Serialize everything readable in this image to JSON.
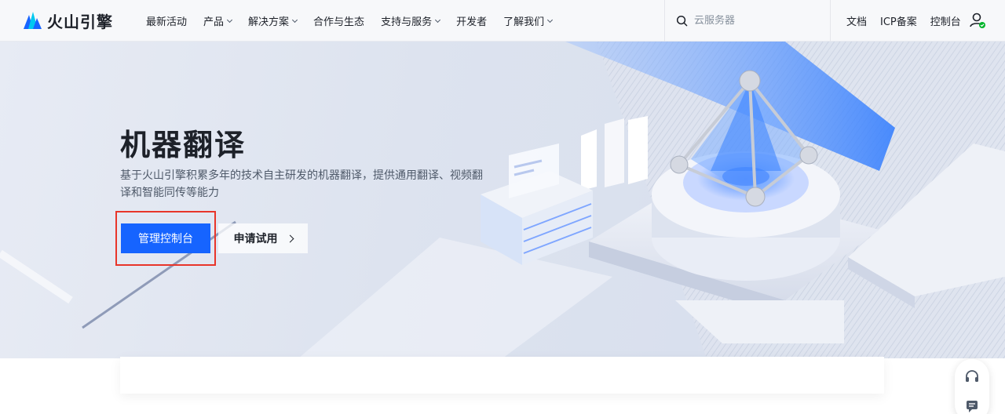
{
  "brand": {
    "name": "火山引擎"
  },
  "nav": {
    "items": [
      {
        "label": "最新活动",
        "has_dropdown": false
      },
      {
        "label": "产品",
        "has_dropdown": true
      },
      {
        "label": "解决方案",
        "has_dropdown": true
      },
      {
        "label": "合作与生态",
        "has_dropdown": false
      },
      {
        "label": "支持与服务",
        "has_dropdown": true
      },
      {
        "label": "开发者",
        "has_dropdown": false
      },
      {
        "label": "了解我们",
        "has_dropdown": true
      }
    ],
    "search_placeholder": "云服务器",
    "right_links": [
      "文档",
      "ICP备案",
      "控制台"
    ]
  },
  "hero": {
    "title": "机器翻译",
    "description": "基于火山引擎积累多年的技术自主研发的机器翻译，提供通用翻译、视频翻译和智能同传等能力",
    "primary_button": "管理控制台",
    "secondary_button": "申请试用"
  },
  "icons": {
    "search": "search-icon",
    "user": "user-icon",
    "headset": "headset-icon",
    "chat": "chat-icon"
  },
  "colors": {
    "primary": "#1664ff",
    "highlight": "#e8352a",
    "online": "#00b42a"
  }
}
